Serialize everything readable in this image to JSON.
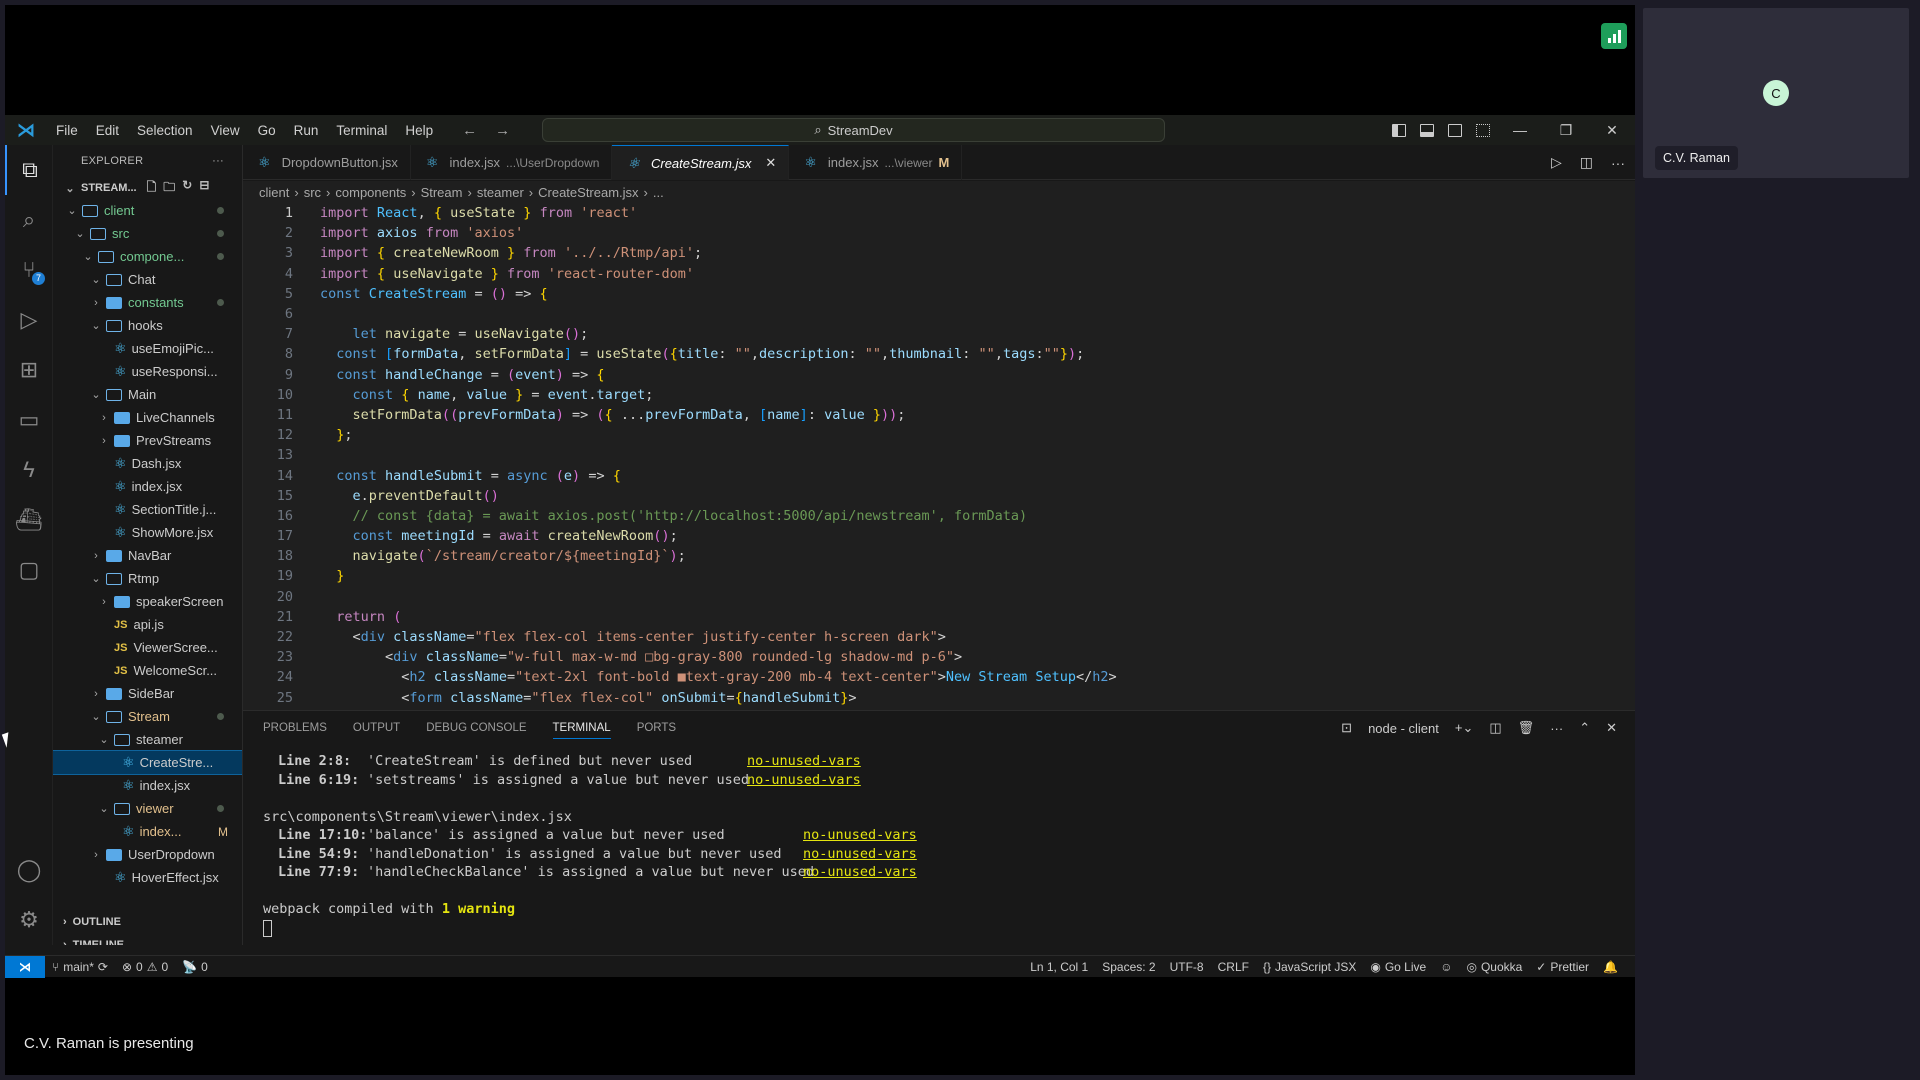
{
  "meeting": {
    "presenting_text": "C.V. Raman is presenting",
    "participant_name": "C.V. Raman",
    "participant_initial": "C",
    "avatar_color": "#c8f5d6"
  },
  "titlebar": {
    "menu": [
      "File",
      "Edit",
      "Selection",
      "View",
      "Go",
      "Run",
      "Terminal",
      "Help"
    ],
    "search_text": "StreamDev"
  },
  "activity": {
    "scm_badge": "7"
  },
  "sidebar": {
    "title": "EXPLORER",
    "root": "STREAM...",
    "tree": [
      {
        "label": "client",
        "type": "folder-open",
        "depth": 1,
        "color": "green",
        "dot": true
      },
      {
        "label": "src",
        "type": "folder-open",
        "depth": 2,
        "color": "green",
        "dot": true
      },
      {
        "label": "compone...",
        "type": "folder-open",
        "depth": 3,
        "color": "green",
        "dot": true
      },
      {
        "label": "Chat",
        "type": "folder-open",
        "depth": 4
      },
      {
        "label": "constants",
        "type": "folder-closed",
        "depth": 4,
        "color": "green",
        "dot": true
      },
      {
        "label": "hooks",
        "type": "folder-open",
        "depth": 4
      },
      {
        "label": "useEmojiPic...",
        "type": "react",
        "depth": 5
      },
      {
        "label": "useResponsi...",
        "type": "react",
        "depth": 5
      },
      {
        "label": "Main",
        "type": "folder-open",
        "depth": 4
      },
      {
        "label": "LiveChannels",
        "type": "folder-closed",
        "depth": 5
      },
      {
        "label": "PrevStreams",
        "type": "folder-closed",
        "depth": 5
      },
      {
        "label": "Dash.jsx",
        "type": "react",
        "depth": 5
      },
      {
        "label": "index.jsx",
        "type": "react",
        "depth": 5
      },
      {
        "label": "SectionTitle.j...",
        "type": "react",
        "depth": 5
      },
      {
        "label": "ShowMore.jsx",
        "type": "react",
        "depth": 5
      },
      {
        "label": "NavBar",
        "type": "folder-closed",
        "depth": 4
      },
      {
        "label": "Rtmp",
        "type": "folder-open",
        "depth": 4
      },
      {
        "label": "speakerScreen",
        "type": "folder-closed",
        "depth": 5
      },
      {
        "label": "api.js",
        "type": "js",
        "depth": 5
      },
      {
        "label": "ViewerScree...",
        "type": "js",
        "depth": 5
      },
      {
        "label": "WelcomeScr...",
        "type": "js",
        "depth": 5
      },
      {
        "label": "SideBar",
        "type": "folder-closed",
        "depth": 4
      },
      {
        "label": "Stream",
        "type": "folder-open",
        "depth": 4,
        "color": "yellow",
        "dot": true
      },
      {
        "label": "steamer",
        "type": "folder-open",
        "depth": 5
      },
      {
        "label": "CreateStre...",
        "type": "react",
        "depth": 6,
        "selected": true
      },
      {
        "label": "index.jsx",
        "type": "react",
        "depth": 6
      },
      {
        "label": "viewer",
        "type": "folder-open",
        "depth": 5,
        "color": "yellow",
        "dot": true
      },
      {
        "label": "index...",
        "type": "react",
        "depth": 6,
        "color": "yellow",
        "mod": "M"
      },
      {
        "label": "UserDropdown",
        "type": "folder-closed",
        "depth": 4
      },
      {
        "label": "HoverEffect.jsx",
        "type": "react",
        "depth": 5
      }
    ],
    "outline": "OUTLINE",
    "timeline": "TIMELINE"
  },
  "tabs": [
    {
      "name": "DropdownButton.jsx",
      "path": "",
      "active": false
    },
    {
      "name": "index.jsx",
      "path": "...\\UserDropdown",
      "active": false
    },
    {
      "name": "CreateStream.jsx",
      "path": "",
      "active": true,
      "close": "✕"
    },
    {
      "name": "index.jsx",
      "path": "...\\viewer",
      "active": false,
      "modified": "M"
    }
  ],
  "breadcrumb": [
    "client",
    "src",
    "components",
    "Stream",
    "steamer",
    "CreateStream.jsx",
    "..."
  ],
  "editor": {
    "current_line": 1,
    "lines": [
      "import React, { useState } from 'react'",
      "import axios from 'axios'",
      "import { createNewRoom } from '../../Rtmp/api';",
      "import { useNavigate } from 'react-router-dom'",
      "const CreateStream = () => {",
      "",
      "    let navigate = useNavigate();",
      "  const [formData, setFormData] = useState({title: \"\",description: \"\",thumbnail: \"\",tags:\"\"});",
      "  const handleChange = (event) => {",
      "    const { name, value } = event.target;",
      "    setFormData((prevFormData) => ({ ...prevFormData, [name]: value }));",
      "  };",
      "",
      "  const handleSubmit = async (e) => {",
      "    e.preventDefault()",
      "    // const {data} = await axios.post('http://localhost:5000/api/newstream', formData)",
      "    const meetingId = await createNewRoom();",
      "    navigate(`/stream/creator/${meetingId}`);",
      "  }",
      "",
      "  return (",
      "    <div className=\"flex flex-col items-center justify-center h-screen dark\">",
      "        <div className=\"w-full max-w-md □bg-gray-800 rounded-lg shadow-md p-6\">",
      "          <h2 className=\"text-2xl font-bold ■text-gray-200 mb-4 text-center\">New Stream Setup</h2>",
      "          <form className=\"flex flex-col\" onSubmit={handleSubmit}>"
    ]
  },
  "panel": {
    "tabs": [
      "PROBLEMS",
      "OUTPUT",
      "DEBUG CONSOLE",
      "TERMINAL",
      "PORTS"
    ],
    "active_tab": "TERMINAL",
    "terminal_name": "node - client",
    "terminal": {
      "group1": [
        {
          "loc": "Line 2:8:",
          "msg": "'CreateStream' is defined but never used",
          "rule": "no-unused-vars"
        },
        {
          "loc": "Line 6:19:",
          "msg": "'setstreams' is assigned a value but never used",
          "rule": "no-unused-vars"
        }
      ],
      "file2": "src\\components\\Stream\\viewer\\index.jsx",
      "group2": [
        {
          "loc": "Line 17:10:",
          "msg": "'balance' is assigned a value but never used",
          "rule": "no-unused-vars"
        },
        {
          "loc": "Line 54:9:",
          "msg": "'handleDonation' is assigned a value but never used",
          "rule": "no-unused-vars"
        },
        {
          "loc": "Line 77:9:",
          "msg": "'handleCheckBalance' is assigned a value but never used",
          "rule": "no-unused-vars"
        }
      ],
      "compiled_prefix": "webpack compiled with ",
      "compiled_warning": "1 warning"
    }
  },
  "statusbar": {
    "branch": "main*",
    "errors": "0",
    "warnings": "0",
    "ports": "0",
    "position": "Ln 1, Col 1",
    "spaces": "Spaces: 2",
    "encoding": "UTF-8",
    "eol": "CRLF",
    "language": "JavaScript JSX",
    "go_live": "Go Live",
    "quokka": "Quokka",
    "prettier": "Prettier"
  }
}
